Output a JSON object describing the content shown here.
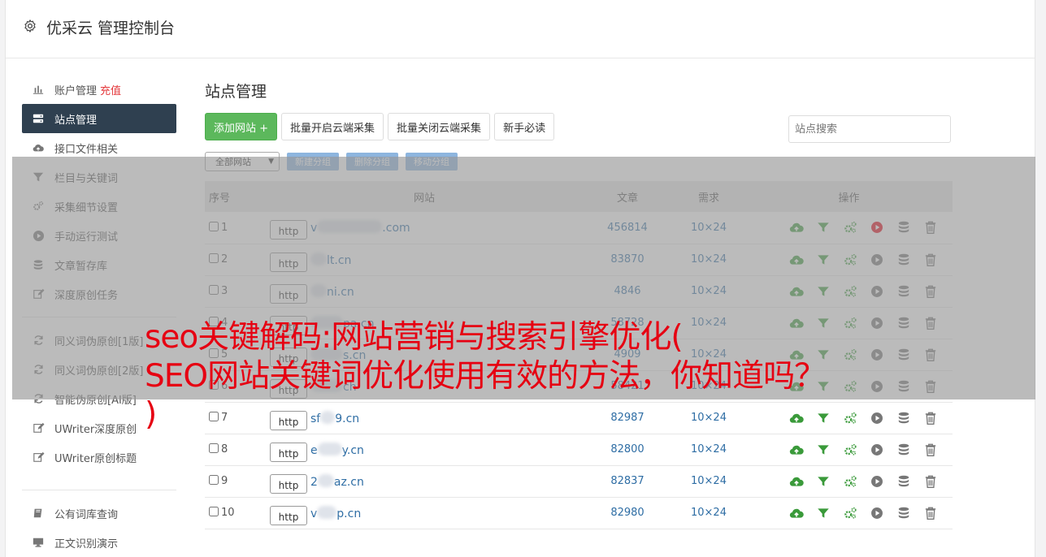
{
  "header": {
    "title": "优采云 管理控制台"
  },
  "sidebar": {
    "items": [
      {
        "label": "账户管理",
        "extra": "充值",
        "icon": "bar-chart-icon"
      },
      {
        "label": "站点管理",
        "icon": "server-icon"
      },
      {
        "label": "接口文件相关",
        "icon": "cloud-upload-icon"
      },
      {
        "label": "栏目与关键词",
        "icon": "filter-icon"
      },
      {
        "label": "采集细节设置",
        "icon": "cogs-icon"
      },
      {
        "label": "手动运行测试",
        "icon": "play-circle-icon"
      },
      {
        "label": "文章暂存库",
        "icon": "database-icon"
      },
      {
        "label": "深度原创任务",
        "icon": "edit-icon"
      }
    ],
    "items2": [
      {
        "label": "同义词伪原创[1版]",
        "icon": "refresh-icon"
      },
      {
        "label": "同义词伪原创[2版]",
        "icon": "refresh-icon"
      },
      {
        "label": "智能伪原创[AI版]",
        "icon": "refresh-icon"
      },
      {
        "label": "UWriter深度原创",
        "icon": "edit-icon"
      },
      {
        "label": "UWriter原创标题",
        "icon": "edit-icon"
      }
    ],
    "items3": [
      {
        "label": "公有词库查询",
        "icon": "book-icon"
      },
      {
        "label": "正文识别演示",
        "icon": "desktop-icon"
      }
    ]
  },
  "main": {
    "title": "站点管理",
    "buttons": {
      "add": "添加网站 +",
      "enable_all": "批量开启云端采集",
      "disable_all": "批量关闭云端采集",
      "guide": "新手必读"
    },
    "search_placeholder": "站点搜索",
    "group_select": "全部网站",
    "group_buttons": {
      "new": "新建分组",
      "delete": "删除分组",
      "move": "移动分组"
    },
    "columns": {
      "no": "序号",
      "site": "网站",
      "articles": "文章",
      "demand": "需求",
      "ops": "操作"
    },
    "rows": [
      {
        "no": "1",
        "proto": "http",
        "prefix": "v",
        "suffix": ".com",
        "blur": 80,
        "articles": "456814",
        "demand": "10×24",
        "running": true
      },
      {
        "no": "2",
        "proto": "http",
        "prefix": "",
        "suffix": "lt.cn",
        "blur": 20,
        "articles": "83870",
        "demand": "10×24",
        "running": false
      },
      {
        "no": "3",
        "proto": "http",
        "prefix": "",
        "suffix": "ni.cn",
        "blur": 20,
        "articles": "4846",
        "demand": "10×24",
        "running": false
      },
      {
        "no": "4",
        "proto": "http",
        "prefix": "",
        "suffix": "pa.cn",
        "blur": 40,
        "articles": "58728",
        "demand": "10×24",
        "running": false
      },
      {
        "no": "5",
        "proto": "http",
        "prefix": "",
        "suffix": "s.cn",
        "blur": 40,
        "articles": "4909",
        "demand": "10×24",
        "running": false
      },
      {
        "no": "6",
        "proto": "http",
        "prefix": "",
        "suffix": "ch",
        "blur": 40,
        "articles": "58421",
        "demand": "10×24",
        "running": false
      },
      {
        "no": "7",
        "proto": "http",
        "prefix": "sf",
        "suffix": "9.cn",
        "blur": 18,
        "articles": "82987",
        "demand": "10×24",
        "running": false
      },
      {
        "no": "8",
        "proto": "http",
        "prefix": "e",
        "suffix": "y.cn",
        "blur": 30,
        "articles": "82800",
        "demand": "10×24",
        "running": false
      },
      {
        "no": "9",
        "proto": "http",
        "prefix": "2",
        "suffix": "az.cn",
        "blur": 20,
        "articles": "82837",
        "demand": "10×24",
        "running": false
      },
      {
        "no": "10",
        "proto": "http",
        "prefix": "v",
        "suffix": "p.cn",
        "blur": 24,
        "articles": "82980",
        "demand": "10×24",
        "running": false
      }
    ]
  },
  "overlay": {
    "line1": "seo关键解码:网站营销与搜索引擎优化(",
    "line2": "SEO网站关键词优化使用有效的方法，你知道吗？",
    "line3": ")"
  },
  "colors": {
    "accent_green": "#5cb85c",
    "sidebar_active": "#2f4050",
    "link_blue": "#2e6da4",
    "headline_red": "#e60012"
  }
}
